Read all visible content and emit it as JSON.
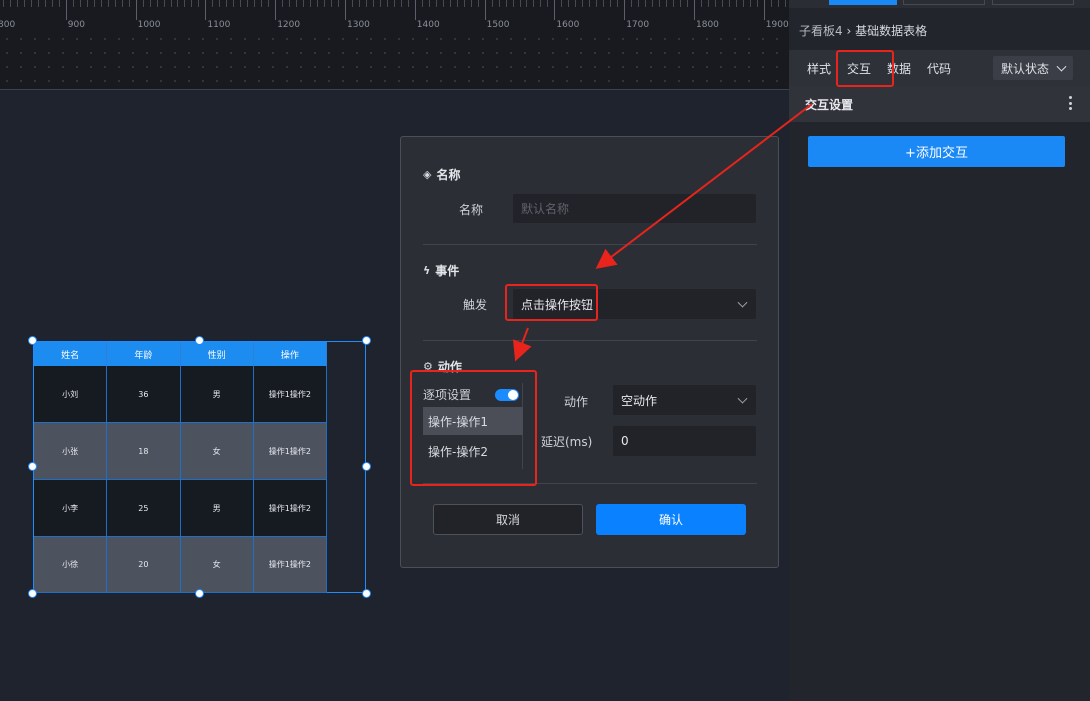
{
  "ruler": {
    "labels": [
      "800",
      "900",
      "1000",
      "1100",
      "1200",
      "1300",
      "1400",
      "1500",
      "1600",
      "1700",
      "1800",
      "1900"
    ]
  },
  "table_widget": {
    "headers": [
      "姓名",
      "年龄",
      "性别",
      "操作"
    ],
    "rows": [
      [
        "小刘",
        "36",
        "男",
        "操作1操作2"
      ],
      [
        "小张",
        "18",
        "女",
        "操作1操作2"
      ],
      [
        "小李",
        "25",
        "男",
        "操作1操作2"
      ],
      [
        "小徐",
        "20",
        "女",
        "操作1操作2"
      ]
    ]
  },
  "dialog": {
    "name_section": {
      "title": "名称",
      "label": "名称",
      "placeholder": "默认名称"
    },
    "event_section": {
      "title": "事件",
      "label": "触发",
      "value": "点击操作按钮"
    },
    "action_section": {
      "title": "动作",
      "per_item_label": "逐项设置",
      "per_item_enabled": true,
      "items": [
        "操作-操作1",
        "操作-操作2"
      ],
      "selected_item": "操作-操作1",
      "action_label": "动作",
      "action_value": "空动作",
      "delay_label": "延迟(ms)",
      "delay_value": "0"
    },
    "cancel_label": "取消",
    "ok_label": "确认"
  },
  "right_panel": {
    "breadcrumb_parent": "子看板4",
    "breadcrumb_separator": "›",
    "breadcrumb_current": "基础数据表格",
    "tabs": [
      "样式",
      "交互",
      "数据",
      "代码"
    ],
    "active_tab": "交互",
    "state_select": "默认状态",
    "section_title": "交互设置",
    "add_button": "+添加交互"
  },
  "colors": {
    "accent": "#0a82ff",
    "highlight": "#e8241c",
    "table_header": "#1c8cf0"
  }
}
